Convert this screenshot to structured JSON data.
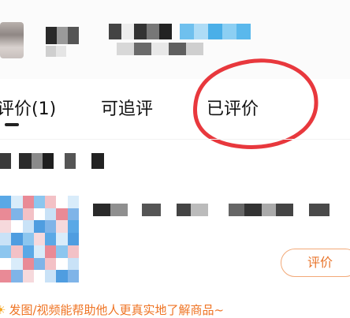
{
  "header": {
    "user_name_redacted": true,
    "user_tag_redacted": true
  },
  "tabs": [
    {
      "label": "评价(1)",
      "active": true
    },
    {
      "label": "可追评",
      "active": false
    },
    {
      "label": "已评价",
      "active": false,
      "highlighted": true
    }
  ],
  "highlight": {
    "color": "#e8383d",
    "shape": "hand-drawn-circle"
  },
  "product": {
    "title_redacted": true,
    "review_button_label": "评价"
  },
  "footer_tip": {
    "icon": "sun-icon",
    "text": "发图/视频能帮助他人更真实地了解商品~"
  },
  "colors": {
    "accent": "#ef7424",
    "button_border": "#f2a978",
    "annotation_red": "#e8383d"
  }
}
